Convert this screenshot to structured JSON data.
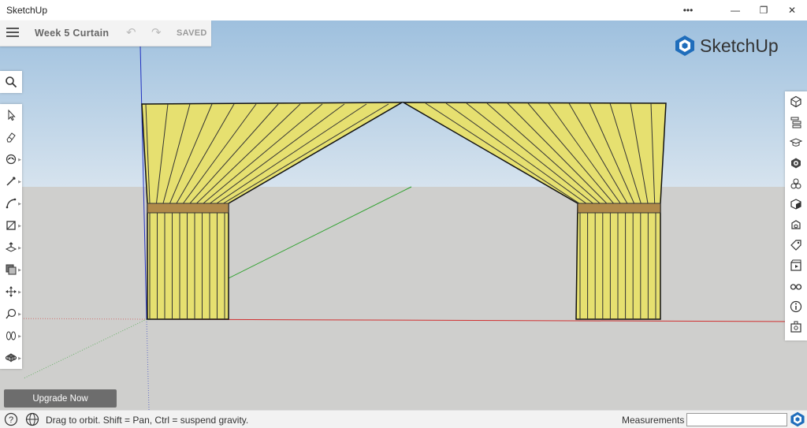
{
  "window": {
    "title": "SketchUp",
    "more_glyph": "•••",
    "minimize_glyph": "—",
    "restore_glyph": "❐",
    "close_glyph": "✕"
  },
  "document": {
    "title": "Week 5 Curtain",
    "undo_glyph": "↶",
    "redo_glyph": "↷",
    "save_status": "SAVED"
  },
  "brand": {
    "logo_text": "SketchUp",
    "color": "#1f6dbb"
  },
  "left_toolbar": {
    "search_icon": "search-icon",
    "tools": [
      {
        "name": "select-icon",
        "has_menu": false
      },
      {
        "name": "eraser-icon",
        "has_menu": false
      },
      {
        "name": "paint-bucket-icon",
        "has_menu": true
      },
      {
        "name": "line-icon",
        "has_menu": true
      },
      {
        "name": "arc-icon",
        "has_menu": true
      },
      {
        "name": "rectangle-icon",
        "has_menu": true
      },
      {
        "name": "push-pull-icon",
        "has_menu": true
      },
      {
        "name": "offset-icon",
        "has_menu": true
      },
      {
        "name": "move-icon",
        "has_menu": true
      },
      {
        "name": "tape-measure-icon",
        "has_menu": true
      },
      {
        "name": "walk-icon",
        "has_menu": true
      },
      {
        "name": "orbit-icon",
        "has_menu": true
      }
    ]
  },
  "right_toolbar": {
    "panels": [
      "entity-info-icon",
      "outliner-icon",
      "instructor-icon",
      "materials-icon",
      "components-icon",
      "styles-icon",
      "3d-warehouse-icon",
      "tags-icon",
      "scenes-icon",
      "display-icon",
      "info-icon",
      "extension-icon"
    ]
  },
  "upgrade": {
    "label": "Upgrade Now"
  },
  "status": {
    "help_glyph": "?",
    "message": "Drag to orbit. Shift = Pan, Ctrl = suspend gravity.",
    "measurements_label": "Measurements",
    "measurements_value": ""
  },
  "scene": {
    "sky_color": "#b7cfe3",
    "ground_color": "#cfcfcd",
    "curtain_color": "#e6e070",
    "tieback_color": "#b08a4a",
    "axis_red": "#d03030",
    "axis_green": "#2aa02a",
    "axis_blue": "#2030c0"
  }
}
